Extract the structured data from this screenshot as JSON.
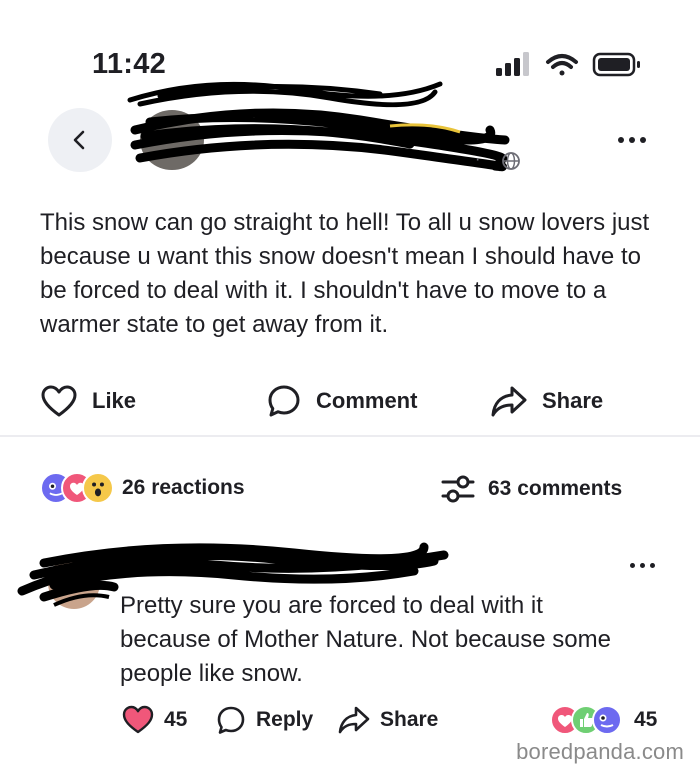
{
  "status_bar": {
    "time": "11:42"
  },
  "post": {
    "text": "This snow can go straight to hell! To all u snow lovers just because u want this snow doesn't mean I should have to be forced to deal with it. I shouldn't have to move to a warmer state to get away from it."
  },
  "actions": {
    "like": "Like",
    "comment": "Comment",
    "share": "Share"
  },
  "summary": {
    "reactions": "26 reactions",
    "comments": "63 comments"
  },
  "comment": {
    "text": "Pretty sure you are forced to deal with it because of Mother Nature.  Not because some people like snow.",
    "like_count": "45",
    "reply": "Reply",
    "share": "Share",
    "reaction_count": "45"
  },
  "watermark": "boredpanda.com",
  "colors": {
    "accent": "#5b4fd6",
    "like_pink": "#f0577a",
    "text": "#1f1f24",
    "divider": "#ececf0"
  }
}
